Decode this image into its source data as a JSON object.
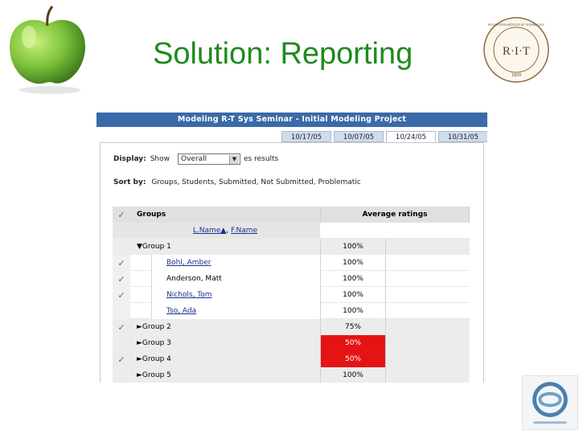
{
  "slide": {
    "title": "Solution: Reporting",
    "seal_text": "R·I·T",
    "seal_ring_text": "ROCHESTER INSTITUTE OF TECHNOLOGY",
    "seal_year": "1829",
    "colors": {
      "title": "#1f8a1f",
      "header_bar": "#3a6aa8",
      "alert": "#e51414"
    }
  },
  "app": {
    "window_title": "Modeling R-T Sys Seminar - Initial Modeling Project",
    "tabs": [
      {
        "label": "10/17/05",
        "active": false
      },
      {
        "label": "10/07/05",
        "active": false
      },
      {
        "label": "10/24/05",
        "active": true
      },
      {
        "label": "10/31/05",
        "active": false
      }
    ],
    "display": {
      "label": "Display:",
      "prefix": "Show",
      "selected": "Overall",
      "suffix": "es results"
    },
    "sort": {
      "label": "Sort by:",
      "options": "Groups, Students, Submitted, Not Submitted, Problematic"
    },
    "grid": {
      "header": {
        "groups": "Groups",
        "average": "Average ratings"
      },
      "subheader": {
        "lname": "L.Name▲",
        "sep": ", ",
        "fname": "F.Name"
      },
      "group1": {
        "label": "▼Group 1",
        "avg": "100%",
        "checked": false
      },
      "students": [
        {
          "name": "Bohl, Amber",
          "avg": "100%",
          "checked": true,
          "link": true
        },
        {
          "name": "Anderson, Matt",
          "avg": "100%",
          "checked": true,
          "link": false
        },
        {
          "name": "Nichols, Tom",
          "avg": "100%",
          "checked": true,
          "link": true
        },
        {
          "name": "Tso, Ada",
          "avg": "100%",
          "checked": false,
          "link": true
        }
      ],
      "groups": [
        {
          "label": "►Group 2",
          "avg": "75%",
          "checked": true,
          "alert": false
        },
        {
          "label": "►Group 3",
          "avg": "50%",
          "checked": false,
          "alert": true
        },
        {
          "label": "►Group 4",
          "avg": "50%",
          "checked": true,
          "alert": true
        },
        {
          "label": "►Group 5",
          "avg": "100%",
          "checked": false,
          "alert": false
        }
      ],
      "check_glyph": "✓"
    }
  },
  "icons": {
    "apple": "green-apple-icon",
    "seal": "rit-seal-icon",
    "se_logo": "software-engineering-logo-icon"
  }
}
